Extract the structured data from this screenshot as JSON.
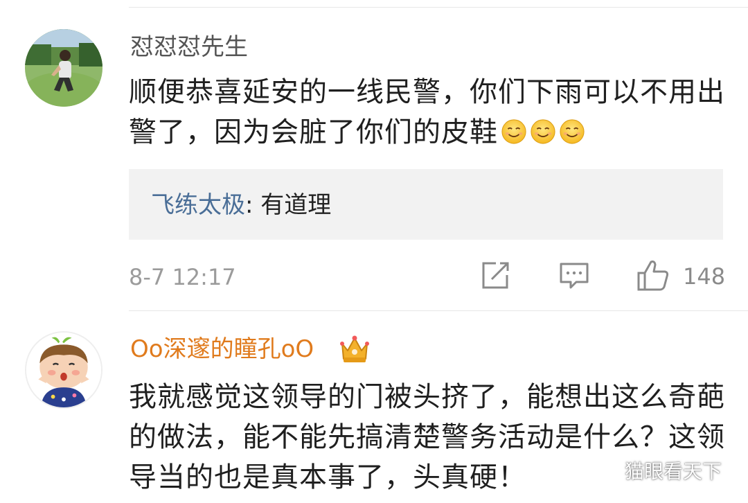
{
  "comments": [
    {
      "username": "怼怼怼先生",
      "text": "顺便恭喜延安的一线民警，你们下雨可以不用出警了，因为会脏了你们的皮鞋",
      "emoji": "smile-emoji",
      "emoji_count": 3,
      "reply": {
        "author": "飞练太极",
        "separator": ": ",
        "text": "有道理"
      },
      "timestamp": "8-7 12:17",
      "like_count": "148"
    },
    {
      "username": "Oo深邃的瞳孔oO",
      "badge": "crown-icon",
      "text": "我就感觉这领导的门被头挤了，能想出这么奇葩的做法，能不能先搞清楚警务活动是什么？这领导当的也是真本事了，头真硬！"
    }
  ],
  "watermark": "猫眼看天下",
  "colors": {
    "reply_author": "#4a6e97",
    "vip_username": "#e07b1d",
    "muted": "#9b9b9b",
    "reply_bg": "#f2f2f2"
  }
}
